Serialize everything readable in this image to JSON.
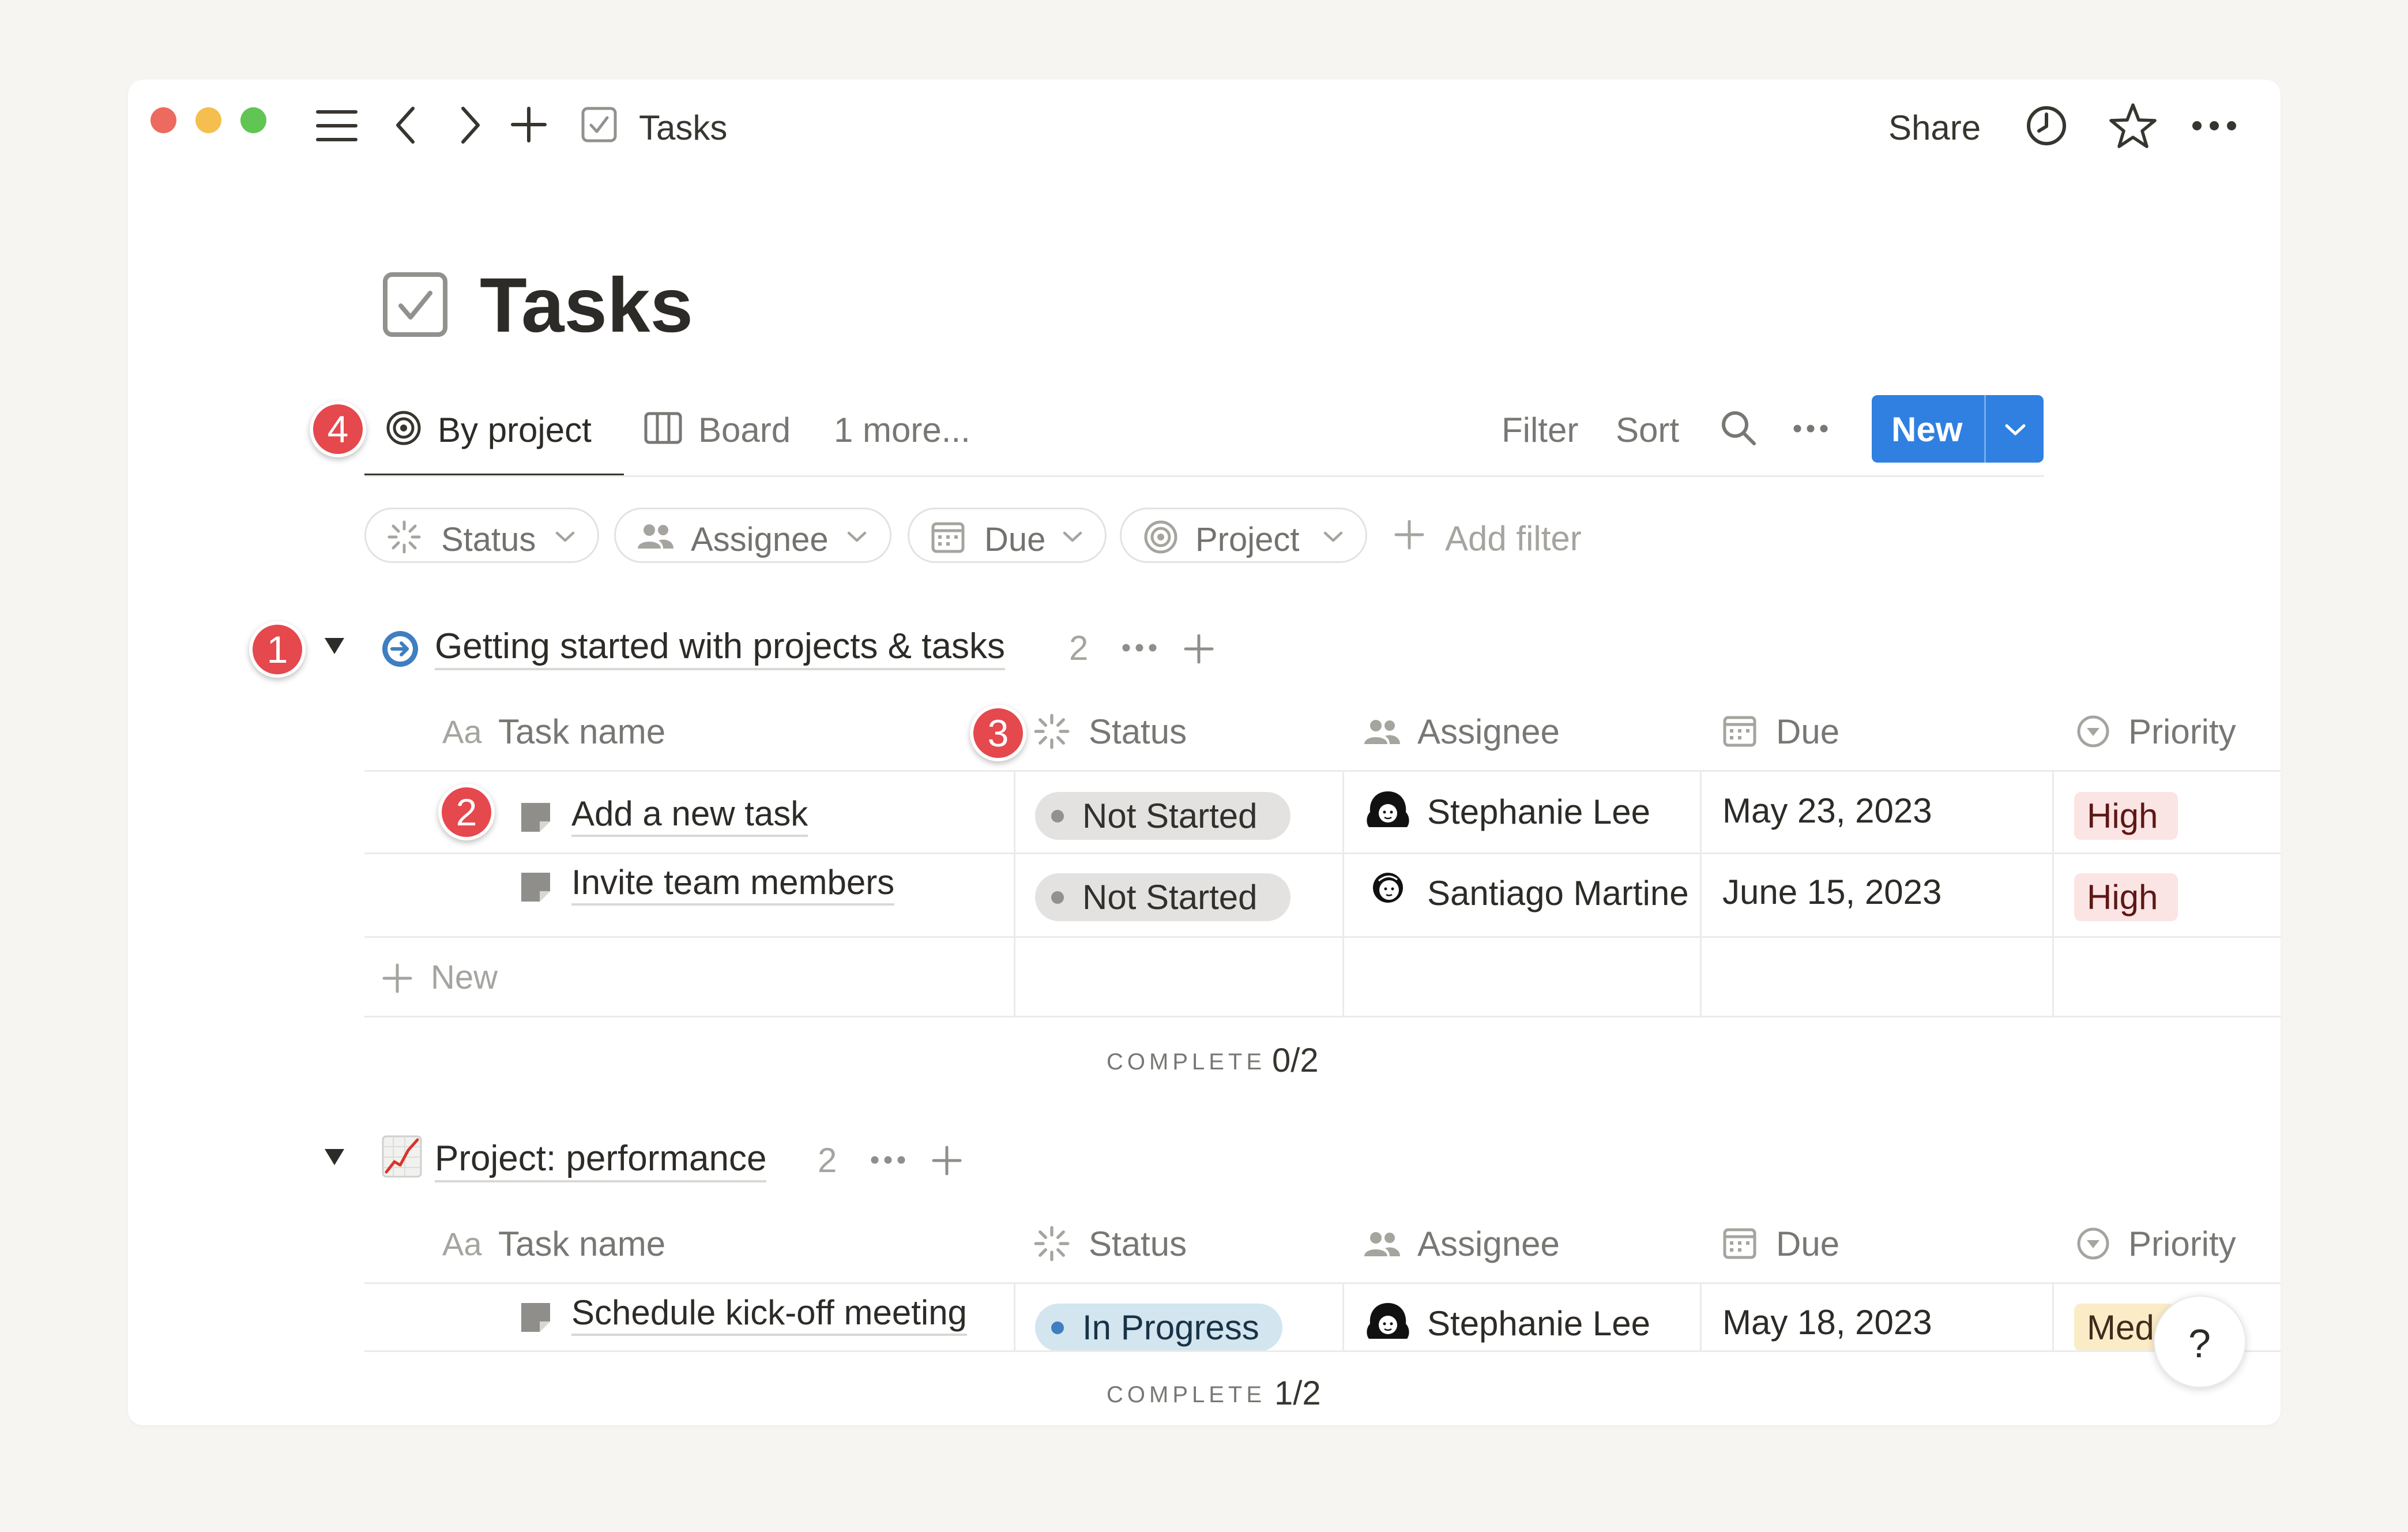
{
  "titlebar": {
    "breadcrumb_title": "Tasks",
    "share_label": "Share"
  },
  "page": {
    "title": "Tasks"
  },
  "views": {
    "tabs": [
      {
        "label": "By project",
        "active": true
      },
      {
        "label": "Board",
        "active": false
      }
    ],
    "more_label": "1 more...",
    "filter_label": "Filter",
    "sort_label": "Sort",
    "new_label": "New"
  },
  "filters": {
    "pills": [
      "Status",
      "Assignee",
      "Due",
      "Project"
    ],
    "add_filter_label": "Add filter"
  },
  "columns": {
    "task_name_prefix": "Aa",
    "task_name": "Task name",
    "status": "Status",
    "assignee": "Assignee",
    "due": "Due",
    "priority": "Priority"
  },
  "groups": [
    {
      "title": "Getting started with projects & tasks",
      "count": "2",
      "rows": [
        {
          "task": "Add a new task",
          "status": "Not Started",
          "assignee": "Stephanie Lee",
          "due": "May 23, 2023",
          "priority": "High"
        },
        {
          "task": "Invite team members",
          "status": "Not Started",
          "assignee": "Santiago Martine",
          "due": "June 15, 2023",
          "priority": "High"
        }
      ],
      "new_row_label": "New",
      "complete_label": "COMPLETE",
      "complete_value": "0/2"
    },
    {
      "title": "Project: performance",
      "count": "2",
      "rows": [
        {
          "task": "Schedule kick-off meeting",
          "status": "In Progress",
          "assignee": "Stephanie Lee",
          "due": "May 18, 2023",
          "priority": "Med"
        }
      ],
      "complete_label": "COMPLETE",
      "complete_value": "1/2"
    }
  ],
  "badges": [
    "1",
    "2",
    "3",
    "4"
  ],
  "help_label": "?",
  "colors": {
    "accent_blue": "#2f80e0",
    "badge_red": "#e5484d",
    "high_priority_bg": "#fbe4e4",
    "medium_priority_bg": "#fbecc8",
    "in_progress_bg": "#d3e5ef",
    "not_started_bg": "#e3e2e0"
  }
}
